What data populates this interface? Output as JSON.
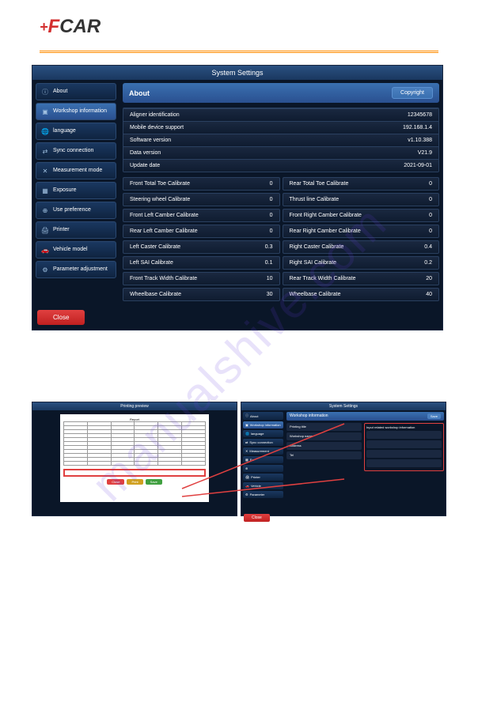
{
  "watermark": "manualshive.com",
  "logo": {
    "plus": "+",
    "f": "F",
    "rest": "CAR"
  },
  "main_window": {
    "title": "System Settings",
    "sidebar": [
      {
        "icon": "ⓘ",
        "label": "About",
        "name": "about"
      },
      {
        "icon": "▣",
        "label": "Workshop information",
        "name": "workshop"
      },
      {
        "icon": "🌐",
        "label": "language",
        "name": "language"
      },
      {
        "icon": "⇄",
        "label": "Sync connection",
        "name": "sync"
      },
      {
        "icon": "✕",
        "label": "Measurement mode",
        "name": "measurement"
      },
      {
        "icon": "▦",
        "label": "Exposure",
        "name": "exposure"
      },
      {
        "icon": "⊕",
        "label": "Use preference",
        "name": "preference"
      },
      {
        "icon": "🖨",
        "label": "Printer",
        "name": "printer"
      },
      {
        "icon": "🚗",
        "label": "Vehicle model",
        "name": "vehicle"
      },
      {
        "icon": "⚙",
        "label": "Parameter adjustment",
        "name": "parameter"
      }
    ],
    "panel_title": "About",
    "copyright_btn": "Copyright",
    "info": [
      {
        "label": "Aligner identification",
        "value": "12345678"
      },
      {
        "label": "Mobile device support",
        "value": "192.168.1.4"
      },
      {
        "label": "Software version",
        "value": "v1.10.388"
      },
      {
        "label": "Data version",
        "value": "V21.9"
      },
      {
        "label": "Update date",
        "value": "2021-09-01"
      }
    ],
    "calibrations": [
      {
        "label": "Front Total Toe Calibrate",
        "value": "0"
      },
      {
        "label": "Rear Total Toe Calibrate",
        "value": "0"
      },
      {
        "label": "Steering wheel Calibrate",
        "value": "0"
      },
      {
        "label": "Thrust line Calibrate",
        "value": "0"
      },
      {
        "label": "Front Left Camber Calibrate",
        "value": "0"
      },
      {
        "label": "Front Right Camber Calibrate",
        "value": "0"
      },
      {
        "label": "Rear Left Camber Calibrate",
        "value": "0"
      },
      {
        "label": "Rear Right Camber Calibrate",
        "value": "0"
      },
      {
        "label": "Left Caster Calibrate",
        "value": "0.3"
      },
      {
        "label": "Right Caster Calibrate",
        "value": "0.4"
      },
      {
        "label": "Left SAI Calibrate",
        "value": "0.1"
      },
      {
        "label": "Right SAI Calibrate",
        "value": "0.2"
      },
      {
        "label": "Front Track Width Calibrate",
        "value": "10"
      },
      {
        "label": "Rear Track Width Calibrate",
        "value": "20"
      },
      {
        "label": "Wheelbase Calibrate",
        "value": "30"
      },
      {
        "label": "Wheelbase Calibrate",
        "value": "40"
      }
    ],
    "close_btn": "Close"
  },
  "mini_left": {
    "title": "Printing preview",
    "buttons": {
      "close": "Close",
      "print": "Print",
      "save": "Save"
    }
  },
  "mini_right": {
    "title": "System Settings",
    "sidebar": [
      {
        "icon": "ⓘ",
        "label": "About"
      },
      {
        "icon": "▣",
        "label": "Workshop information"
      },
      {
        "icon": "🌐",
        "label": "language"
      },
      {
        "icon": "⇄",
        "label": "Sync connection"
      },
      {
        "icon": "✕",
        "label": "Measurement"
      },
      {
        "icon": "▦",
        "label": "Ex"
      },
      {
        "icon": "⊕",
        "label": ""
      },
      {
        "icon": "🖨",
        "label": "Printer"
      },
      {
        "icon": "🚗",
        "label": "Vehicle"
      },
      {
        "icon": "⚙",
        "label": "Parameter"
      }
    ],
    "panel_title": "Workshop information",
    "save_btn": "Save",
    "fields": [
      "Printing title",
      "Workshop name",
      "Address",
      "Tel"
    ],
    "close_btn": "Close"
  }
}
